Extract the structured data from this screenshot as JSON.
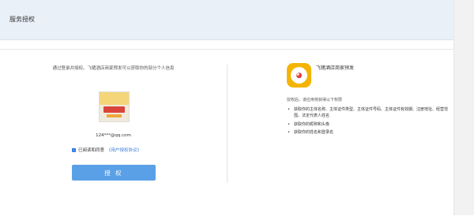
{
  "header": {
    "title": "服务授权"
  },
  "left": {
    "intro": "通过登录并授权。飞猪酒店商家预发可以获取你的部分个人信息",
    "email": "124***@qq.com",
    "agree_text": "已阅读和同意",
    "agreement_link": "《用户授权协议》",
    "authorize_button": "授 权"
  },
  "right": {
    "app_name": "飞猪酒店商家预发",
    "permissions_title": "授权后，该应用将获得以下权限",
    "permissions": [
      "获取你的主体名称、主体证件类型、主体证件号码、主体证件有效期、注册地址、经营范围、法定代表人姓名",
      "获取你的昵称和头像",
      "获取你的姓名和登录名"
    ]
  },
  "colors": {
    "primary_button": "#5aa0e6",
    "header_bg": "#eaf0f8",
    "link": "#3a7bd5"
  }
}
